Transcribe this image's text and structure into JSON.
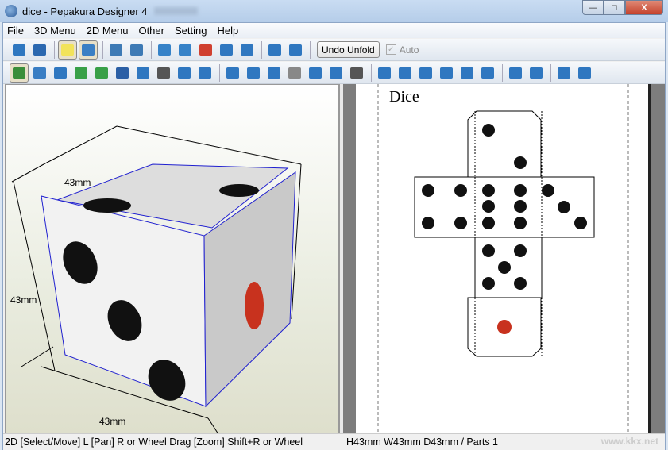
{
  "window": {
    "title": "dice - Pepakura Designer 4",
    "minimize": "—",
    "maximize": "□",
    "close": "X"
  },
  "menu": [
    "File",
    "3D Menu",
    "2D Menu",
    "Other",
    "Setting",
    "Help"
  ],
  "toolbar1": {
    "icons": [
      {
        "name": "open-folder-icon",
        "color": "#2f77c0"
      },
      {
        "name": "save-icon",
        "color": "#2b68b0"
      },
      "sep",
      {
        "name": "lightbulb-icon",
        "color": "#f2e35a",
        "active": true
      },
      {
        "name": "texture-cube-icon",
        "color": "#3b7fc4",
        "active": true
      },
      "sep",
      {
        "name": "select-part-3d-icon",
        "color": "#3d7ab5"
      },
      {
        "name": "select-face-3d-icon",
        "color": "#3d7ab5"
      },
      "sep",
      {
        "name": "cube-edit-icon",
        "color": "#3682c8"
      },
      {
        "name": "cylinder-icon",
        "color": "#3682c8"
      },
      {
        "name": "axis-icon",
        "color": "#d04030"
      },
      {
        "name": "mirror-icon",
        "color": "#2f77c0"
      },
      {
        "name": "visibility-icon",
        "color": "#2f77c0"
      },
      "sep",
      {
        "name": "split-view-icon",
        "color": "#2f77c0"
      },
      {
        "name": "single-view-icon",
        "color": "#2f77c0"
      },
      "sep"
    ],
    "undo_unfold": "Undo Unfold",
    "auto_label": "Auto",
    "auto_checked": true
  },
  "toolbar2": {
    "icons": [
      {
        "name": "select-move-icon",
        "color": "#3a8e3a",
        "active": true
      },
      {
        "name": "rotate-icon",
        "color": "#3a7ec4"
      },
      {
        "name": "join-edges-icon",
        "color": "#2f77c0"
      },
      {
        "name": "edit-line-icon",
        "color": "#38a048"
      },
      {
        "name": "fold-line-icon",
        "color": "#38a048"
      },
      {
        "name": "text-icon",
        "color": "#2b5fa5"
      },
      {
        "name": "image-icon",
        "color": "#2f77c0"
      },
      {
        "name": "cube-icon",
        "color": "#555"
      },
      {
        "name": "undo-icon",
        "color": "#2f77c0"
      },
      {
        "name": "redo-icon",
        "color": "#2f77c0"
      },
      "sep",
      {
        "name": "unfold-map-icon",
        "color": "#2f77c0"
      },
      {
        "name": "fit-icon",
        "color": "#2f77c0"
      },
      {
        "name": "arrange-icon",
        "color": "#2f77c0"
      },
      {
        "name": "page-number-icon",
        "color": "#888"
      },
      {
        "name": "export-page-icon",
        "color": "#2f77c0"
      },
      {
        "name": "clipboard-icon",
        "color": "#2f77c0"
      },
      {
        "name": "print-icon",
        "color": "#555"
      },
      "sep",
      {
        "name": "align-left-icon",
        "color": "#2f77c0"
      },
      {
        "name": "align-center-icon",
        "color": "#2f77c0"
      },
      {
        "name": "align-right-icon",
        "color": "#2f77c0"
      },
      {
        "name": "align-top-icon",
        "color": "#2f77c0"
      },
      {
        "name": "align-middle-icon",
        "color": "#2f77c0"
      },
      {
        "name": "align-bottom-icon",
        "color": "#2f77c0"
      },
      "sep",
      {
        "name": "flip-left-icon",
        "color": "#2f77c0"
      },
      {
        "name": "flip-right-icon",
        "color": "#2f77c0"
      },
      "sep",
      {
        "name": "group-icon",
        "color": "#2f77c0"
      },
      {
        "name": "ungroup-icon",
        "color": "#2f77c0"
      }
    ]
  },
  "view3d": {
    "dim_top": "43mm",
    "dim_left": "43mm",
    "dim_bottom": "43mm",
    "pip_color": "#111111",
    "accent_pip": "#c8321e",
    "edge_color": "#2020d0"
  },
  "view2d": {
    "page_title": "Dice"
  },
  "status": {
    "left": "2D [Select/Move] L [Pan] R or Wheel Drag [Zoom] Shift+R or Wheel",
    "right": "H43mm W43mm D43mm / Parts 1",
    "watermark": "www.kkx.net"
  }
}
